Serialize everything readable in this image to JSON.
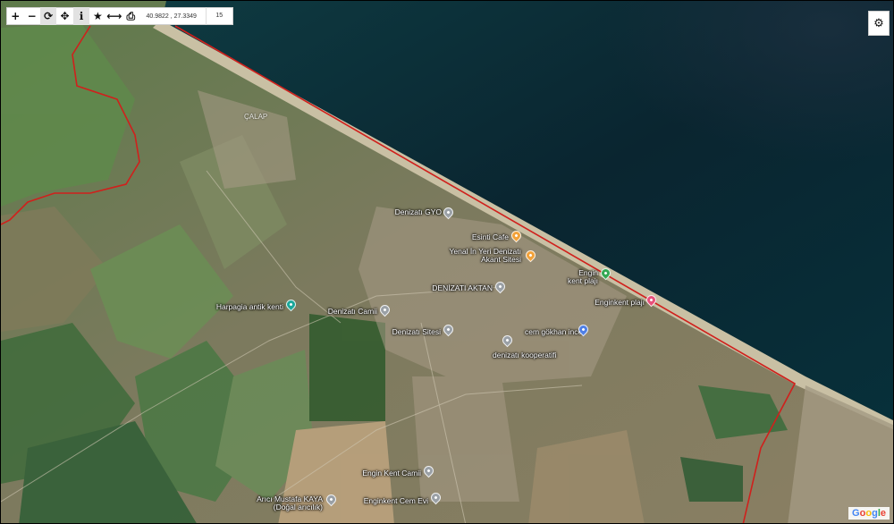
{
  "toolbar": {
    "buttons": [
      {
        "name": "zoom-in-button",
        "glyph": "+"
      },
      {
        "name": "zoom-out-button",
        "glyph": "−"
      },
      {
        "name": "refresh-button",
        "glyph": "⟳"
      },
      {
        "name": "locate-button",
        "glyph": "✥"
      },
      {
        "name": "info-button",
        "glyph": "ℹ"
      },
      {
        "name": "favorite-button",
        "glyph": "★"
      },
      {
        "name": "measure-button",
        "glyph": "⟷"
      },
      {
        "name": "print-button",
        "glyph": "⎙"
      }
    ],
    "coordinates": "40.9822 , 27.3349",
    "zoom_level": "15"
  },
  "settings_icon": "gear-icon",
  "map": {
    "type": "satellite",
    "boundary_color": "#d0201c",
    "sea_color": "#0b2a33",
    "labels": [
      {
        "text": "Denizatı GYO",
        "pin_color": "#9aa0a6"
      },
      {
        "text": "Esinti Cafe",
        "pin_color": "#f2a23a"
      },
      {
        "text": "Yenal İn Yeri Denizatı Akant Sitesi",
        "pin_color": "#f2a23a"
      },
      {
        "text": "Engin kent plajı",
        "pin_color": "#34a853"
      },
      {
        "text": "Enginkent plajı",
        "pin_color": "#e8507a"
      },
      {
        "text": "DENİZATI AKTAN",
        "pin_color": "#9aa0a6"
      },
      {
        "text": "Harpagia antik kenti",
        "pin_color": "#1aa79a"
      },
      {
        "text": "Denizatı Camii",
        "pin_color": "#9aa0a6"
      },
      {
        "text": "Denizatı Sitesi",
        "pin_color": "#9aa0a6"
      },
      {
        "text": "cem gökhan ince",
        "pin_color": "#4f7fe6"
      },
      {
        "text": "denizatı kooperatifi",
        "pin_color": "#9aa0a6"
      },
      {
        "text": "Engin Kent Camii",
        "pin_color": "#9aa0a6"
      },
      {
        "text": "Arıcı Mustafa KAYA (Doğal arıcılık)",
        "pin_color": "#9aa0a6"
      },
      {
        "text": "Enginkent Cem Evi",
        "pin_color": "#9aa0a6"
      }
    ],
    "town_label": "ÇALAP"
  },
  "attribution": "Google"
}
